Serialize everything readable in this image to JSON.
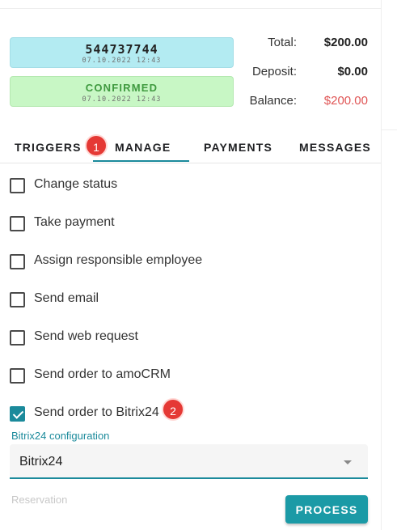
{
  "order": {
    "id": "544737744",
    "id_date": "07.10.2022 12:43",
    "status": "CONFIRMED",
    "status_date": "07.10.2022 12:43",
    "status_color": "#c8f7c5",
    "id_color": "#b3ebf2"
  },
  "summary": {
    "total_label": "Total:",
    "total_value": "$200.00",
    "deposit_label": "Deposit:",
    "deposit_value": "$0.00",
    "balance_label": "Balance:",
    "balance_value": "$200.00",
    "balance_color": "#e05656"
  },
  "tabs": [
    {
      "label": "TRIGGERS",
      "active": false
    },
    {
      "label": "MANAGE",
      "active": true
    },
    {
      "label": "PAYMENTS",
      "active": false
    },
    {
      "label": "MESSAGES",
      "active": false
    }
  ],
  "badges": [
    "1",
    "2"
  ],
  "actions": [
    {
      "label": "Change status",
      "checked": false
    },
    {
      "label": "Take payment",
      "checked": false
    },
    {
      "label": "Assign responsible employee",
      "checked": false
    },
    {
      "label": "Send email",
      "checked": false
    },
    {
      "label": "Send web request",
      "checked": false
    },
    {
      "label": "Send order to amoCRM",
      "checked": false
    },
    {
      "label": "Send order to Bitrix24",
      "checked": true
    }
  ],
  "config": {
    "label": "Bitrix24 configuration",
    "selected": "Bitrix24"
  },
  "reservation_label": "Reservation",
  "process_label": "PROCESS",
  "accent_color": "#1b8a9b"
}
